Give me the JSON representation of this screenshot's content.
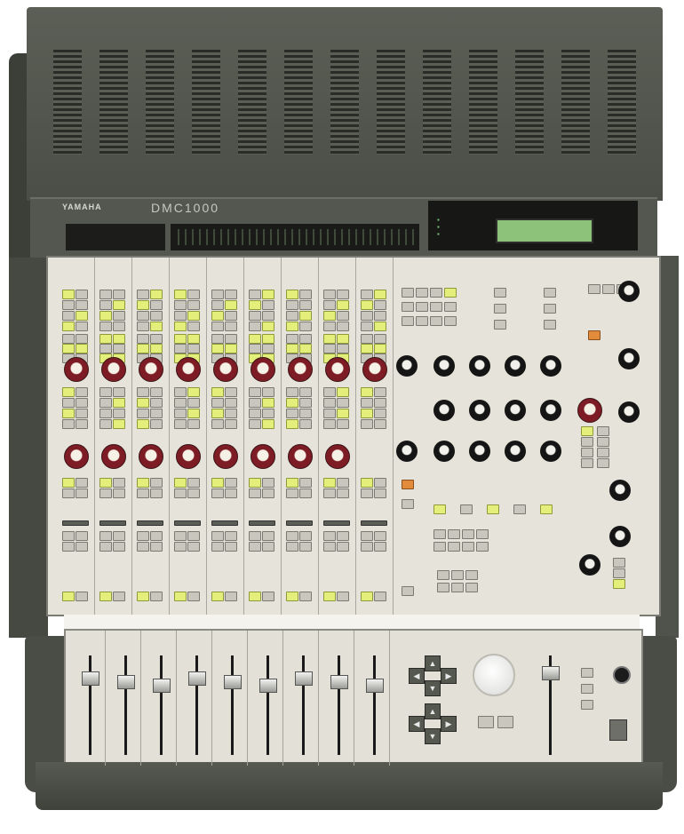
{
  "device": {
    "brand": "YAMAHA",
    "model": "DMC1000"
  },
  "colors": {
    "chassis": "#4a4e46",
    "panel": "#e5e3da",
    "knob_red": "#7d1c24",
    "button_yellow": "#e3ef7a",
    "lcd_green": "#8cc27a"
  }
}
